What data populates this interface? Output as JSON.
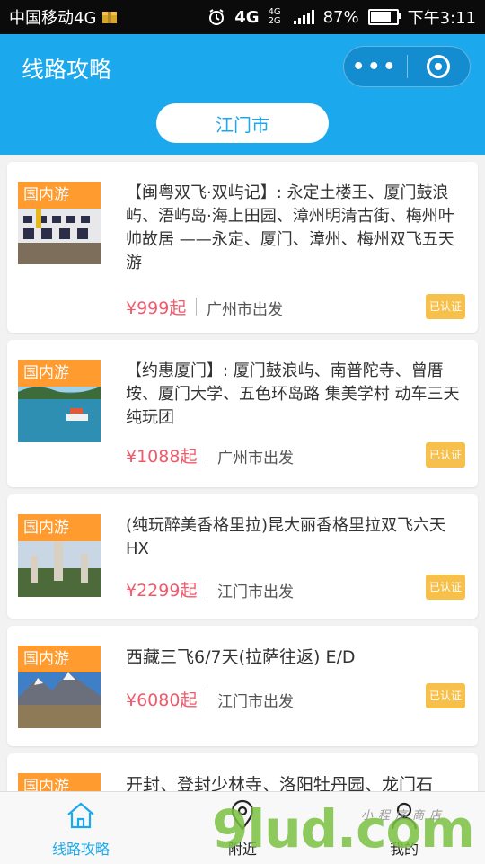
{
  "status_bar": {
    "carrier": "中国移动4G",
    "network": "4G",
    "network_small": "4G 2G",
    "battery": "87%",
    "time": "下午3:11"
  },
  "header": {
    "title": "线路攻略",
    "more_dots": "•••",
    "city": "江门市"
  },
  "routes": [
    {
      "badge": "国内游",
      "title": "【闽粤双飞·双屿记】: 永定土楼王、厦门鼓浪屿、浯屿岛·海上田园、漳州明清古街、梅州叶帅故居 ——永定、厦门、漳州、梅州双飞五天游",
      "price": "¥999起",
      "departure": "广州市出发",
      "verified": "已认证"
    },
    {
      "badge": "国内游",
      "title": "【约惠厦门】: 厦门鼓浪屿、南普陀寺、曾厝垵、厦门大学、五色环岛路 集美学村 动车三天纯玩团",
      "price": "¥1088起",
      "departure": "广州市出发",
      "verified": "已认证"
    },
    {
      "badge": "国内游",
      "title": "(纯玩醉美香格里拉)昆大丽香格里拉双飞六天HX",
      "price": "¥2299起",
      "departure": "江门市出发",
      "verified": "已认证"
    },
    {
      "badge": "国内游",
      "title": "西藏三飞6/7天(拉萨往返) E/D",
      "price": "¥6080起",
      "departure": "江门市出发",
      "verified": "已认证"
    },
    {
      "badge": "国内游",
      "title": "开封、登封少林寺、洛阳牡丹园、龙门石"
    }
  ],
  "bottom_nav": [
    {
      "label": "线路攻略",
      "icon": "home-icon",
      "active": true
    },
    {
      "label": "附近",
      "icon": "location-pin-icon",
      "active": false
    },
    {
      "label": "我的",
      "icon": "user-icon",
      "active": false
    }
  ],
  "watermark": {
    "text": "9lud.com",
    "subtext": "小程序商店"
  },
  "colors": {
    "header_bg": "#1ca8ec",
    "badge": "#ff9b2f",
    "price": "#f05a6b",
    "verified": "#f6c04b",
    "watermark_green": "#7bc143"
  }
}
